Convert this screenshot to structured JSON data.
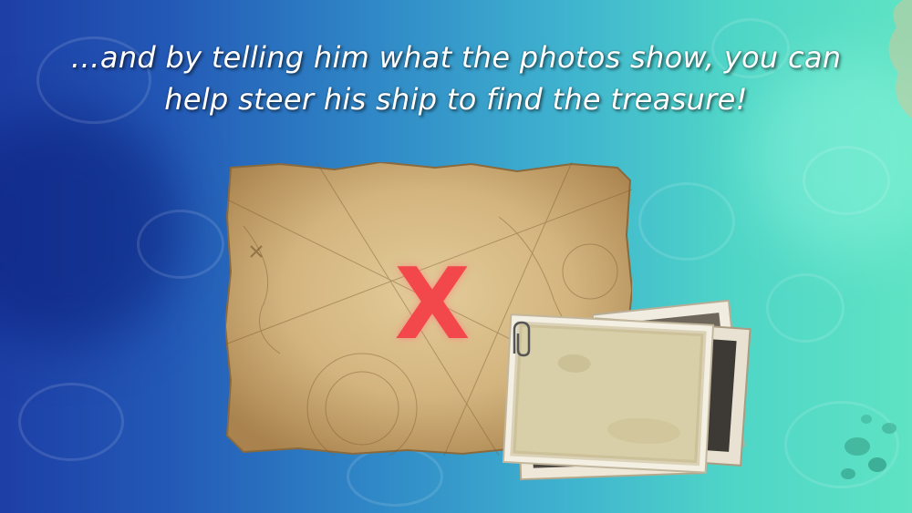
{
  "caption": {
    "line1": "…and by telling him what the photos show, you can",
    "line2": "help steer his ship to find the treasure!"
  },
  "map": {
    "mark": "X",
    "mark_color": "#f2474b"
  },
  "colors": {
    "background_left": "#1d3fa6",
    "background_right": "#5fe3c4",
    "parchment": "#d3b47e"
  }
}
